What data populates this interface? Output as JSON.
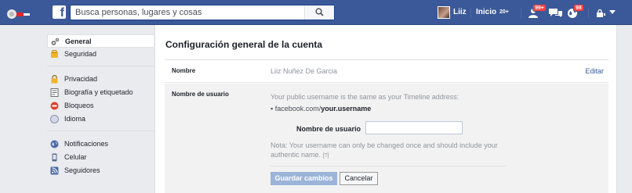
{
  "topbar": {
    "search_placeholder": "Busca personas, lugares y cosas",
    "user_name": "Liiz",
    "home_label": "Inicio",
    "home_count": "20+",
    "friend_requests_badge": "99+",
    "notifications_badge": "98",
    "brand_color": "#3b5998",
    "badge_color": "#fa3e3e"
  },
  "sidebar": {
    "groups": [
      {
        "items": [
          {
            "label": "General",
            "icon": "gear-icon",
            "active": true
          },
          {
            "label": "Seguridad",
            "icon": "shield-icon"
          }
        ]
      },
      {
        "items": [
          {
            "label": "Privacidad",
            "icon": "lock-icon"
          },
          {
            "label": "Biografía y etiquetado",
            "icon": "timeline-icon"
          },
          {
            "label": "Bloqueos",
            "icon": "block-icon"
          },
          {
            "label": "Idioma",
            "icon": "globe-icon"
          }
        ]
      },
      {
        "items": [
          {
            "label": "Notificaciones",
            "icon": "globe-icon"
          },
          {
            "label": "Celular",
            "icon": "mobile-icon"
          },
          {
            "label": "Seguidores",
            "icon": "rss-icon"
          }
        ]
      }
    ]
  },
  "main": {
    "title": "Configuración general de la cuenta",
    "name_row": {
      "label": "Nombre",
      "value": "Liiz Nuñez De Garcia",
      "edit_label": "Editar"
    },
    "username_row": {
      "label": "Nombre de usuario",
      "description": "Your public username is the same as your Timeline address:",
      "url_prefix": "facebook.com/",
      "url_username": "your.username",
      "field_label": "Nombre de usuario",
      "field_value": "",
      "note": "Nota: Your username can only be changed once and should include your authentic name.",
      "help_label": "[?]",
      "save_label": "Guardar cambios",
      "cancel_label": "Cancelar"
    }
  }
}
